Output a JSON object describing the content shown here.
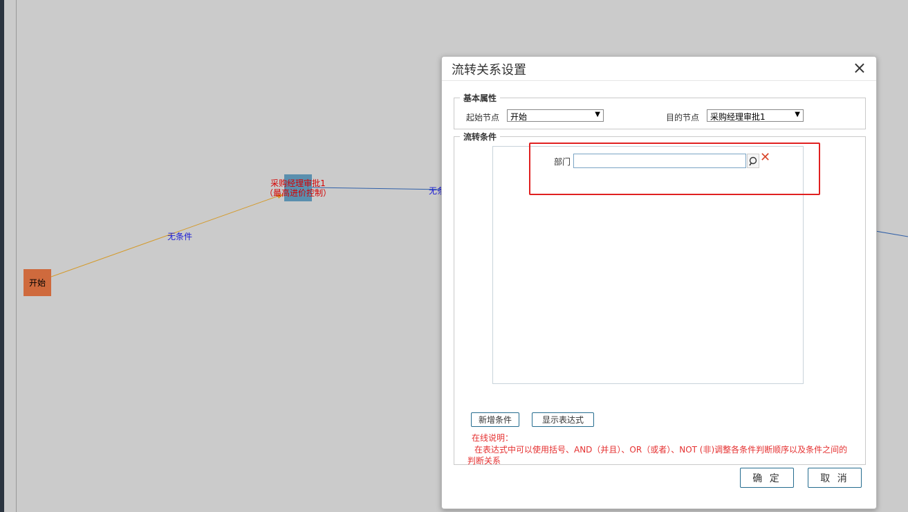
{
  "workflow": {
    "start_node": "开始",
    "task_node_line1": "采购经理审批1",
    "task_node_line2": "（最高进价控制）",
    "edge1_label": "无条件",
    "edge2_label_partial": "无条"
  },
  "dialog": {
    "title": "流转关系设置",
    "close_icon": "×",
    "basic": {
      "legend": "基本属性",
      "from_label": "起始节点",
      "from_value": "开始",
      "to_label": "目的节点",
      "to_value": "采购经理审批1",
      "select_arrow": "▼"
    },
    "condition": {
      "legend": "流转条件",
      "dept_label": "部门",
      "dept_value": "",
      "delete_icon": "✕"
    },
    "add_condition_button": "新增条件",
    "show_expression_button": "显示表达式",
    "help_title": "在线说明：",
    "help_text": "在表达式中可以使用括号、AND（并且）、OR（或者）、NOT (非)调整各条件判断顺序以及条件之间的判断关系",
    "ok_button": "确 定",
    "cancel_button": "取 消"
  },
  "colors": {
    "start_node": "#cf6a3d",
    "task_node": "#5a8fae",
    "highlight": "#e02020",
    "help_text": "#e53030"
  }
}
